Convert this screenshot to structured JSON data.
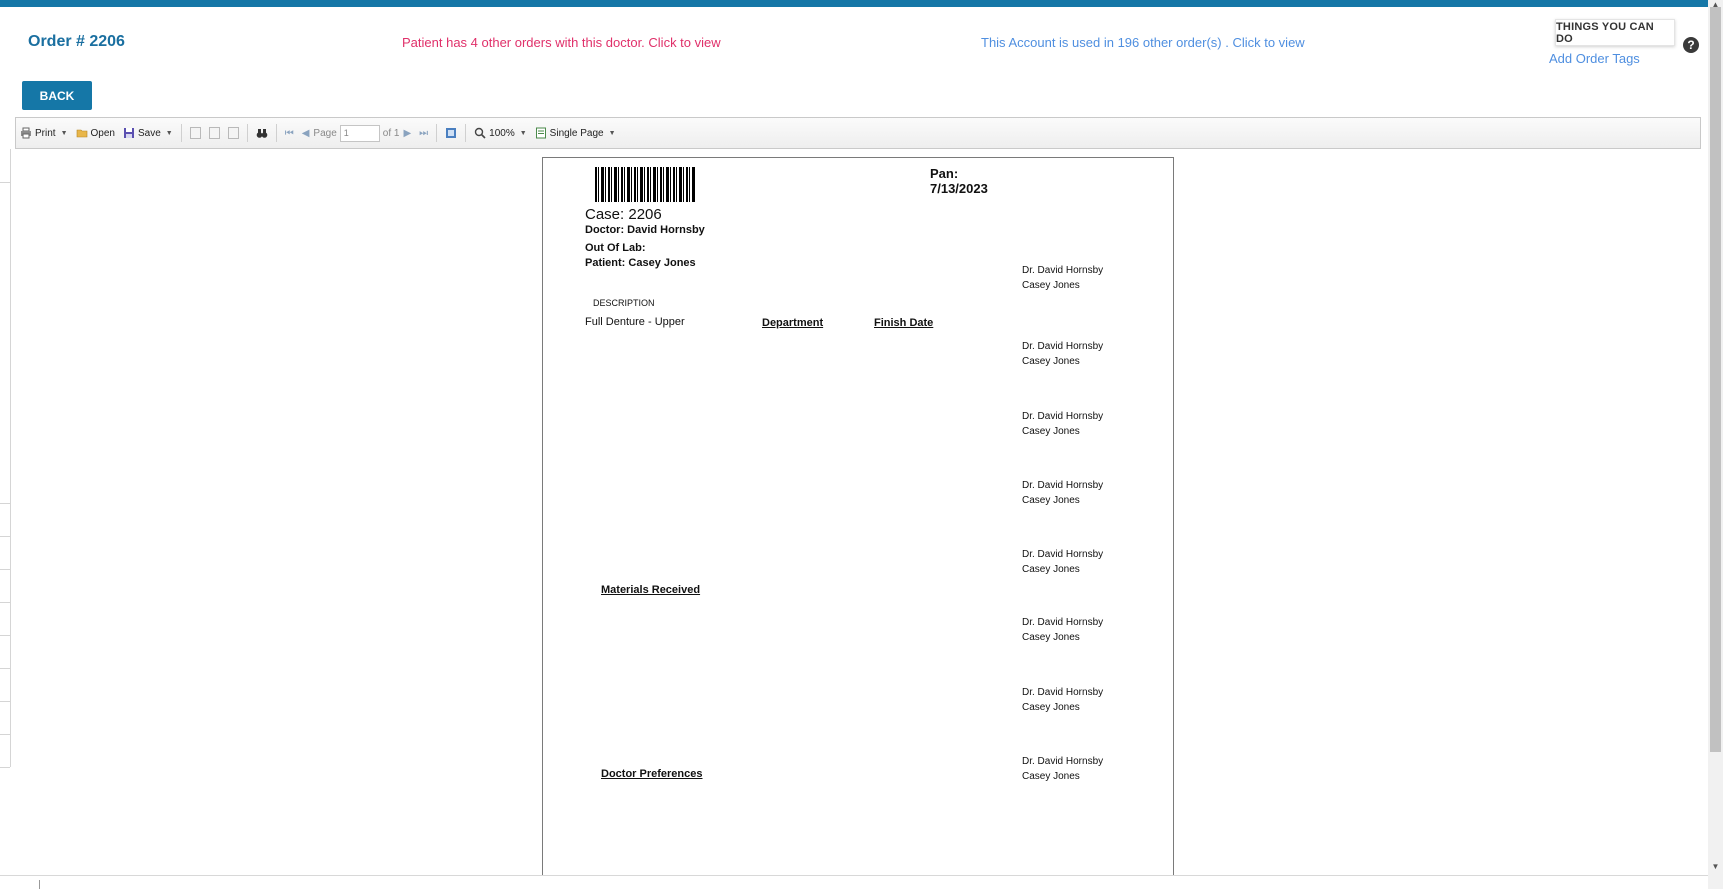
{
  "header": {
    "order_title": "Order # 2206",
    "patient_orders_link": "Patient has 4 other orders with this doctor. Click to view",
    "account_orders_link": "This Account is used in 196 other order(s) . Click to view",
    "things_you_can_do": "THINGS YOU CAN DO",
    "help_icon": "?",
    "add_order_tags": "Add Order Tags",
    "back_label": "BACK"
  },
  "toolbar": {
    "print_label": "Print",
    "open_label": "Open",
    "save_label": "Save",
    "page_label": "Page",
    "page_value": "1",
    "page_of": "of 1",
    "zoom_label": "100%",
    "view_mode_label": "Single Page"
  },
  "document": {
    "case": "Case: 2206",
    "doctor": "Doctor: David Hornsby",
    "out_of_lab": "Out Of Lab:",
    "patient": "Patient: Casey Jones",
    "pan_label": "Pan:",
    "date": "7/13/2023",
    "description_header": "DESCRIPTION",
    "item": "Full Denture - Upper",
    "department_header": "Department",
    "finish_date_header": "Finish Date",
    "materials_received": "Materials Received",
    "doctor_preferences": "Doctor Preferences",
    "labels": [
      {
        "doctor": "Dr. David Hornsby",
        "patient": "Casey Jones"
      },
      {
        "doctor": "Dr. David Hornsby",
        "patient": "Casey Jones"
      },
      {
        "doctor": "Dr. David Hornsby",
        "patient": "Casey Jones"
      },
      {
        "doctor": "Dr. David Hornsby",
        "patient": "Casey Jones"
      },
      {
        "doctor": "Dr. David Hornsby",
        "patient": "Casey Jones"
      },
      {
        "doctor": "Dr. David Hornsby",
        "patient": "Casey Jones"
      },
      {
        "doctor": "Dr. David Hornsby",
        "patient": "Casey Jones"
      },
      {
        "doctor": "Dr. David Hornsby",
        "patient": "Casey Jones"
      }
    ]
  },
  "colors": {
    "primary": "#1577a7",
    "patient_link": "#e0306a",
    "account_link": "#4f8fe0"
  },
  "icons": [
    "print-icon",
    "open-folder-icon",
    "save-disk-icon",
    "find-binoculars-icon",
    "first-page-icon",
    "prev-page-icon",
    "next-page-icon",
    "last-page-icon",
    "fullscreen-icon",
    "zoom-icon",
    "single-page-icon",
    "help-icon"
  ]
}
